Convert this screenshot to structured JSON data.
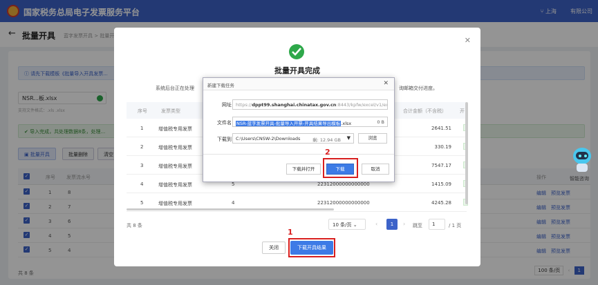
{
  "app": {
    "title": "国家税务总局电子发票服务平台",
    "user": "上海",
    "company": "有限公司"
  },
  "page": {
    "title": "批量开具",
    "breadcrumb_1": "蓝字发票开具",
    "breadcrumb_sep": ">",
    "breadcrumb_2": "批量开..."
  },
  "background": {
    "tip_text": "请先下载模板《批量导入开具发票...",
    "file_name": "NSR...板.xlsx",
    "file_note": "支持文件格式：.xls .xlsx",
    "import_tip": "导入完成，共处理数据8条，处理...",
    "buttons": [
      "批量开具",
      "批量删除",
      "清空"
    ],
    "columns": [
      "序号",
      "发票流水号",
      "操作"
    ],
    "rows": [
      {
        "idx": "1",
        "serial": "8"
      },
      {
        "idx": "2",
        "serial": "7"
      },
      {
        "idx": "3",
        "serial": "6"
      },
      {
        "idx": "4",
        "serial": "5"
      },
      {
        "idx": "5",
        "serial": "4"
      }
    ],
    "actions": [
      "编辑",
      "预览发票"
    ],
    "total": "共 8 条",
    "page_size": "100 条/页",
    "page_current": "1"
  },
  "modal": {
    "title": "批量开具完成",
    "desc_left": "系统后台正在处理",
    "desc_right": "询邮箱交付进度。",
    "columns": [
      "序号",
      "发票类型",
      "合计金额（不含税）",
      "开"
    ],
    "rows": [
      {
        "idx": "1",
        "type": "增值税专用发票",
        "serial": "",
        "no": "",
        "amount": "2641.51"
      },
      {
        "idx": "2",
        "type": "增值税专用发票",
        "serial": "",
        "no": "",
        "amount": "330.19"
      },
      {
        "idx": "3",
        "type": "增值税专用发票",
        "serial": "",
        "no": "",
        "amount": "7547.17"
      },
      {
        "idx": "4",
        "type": "增值税专用发票",
        "serial": "5",
        "no": "22312000000000000",
        "amount": "1415.09"
      },
      {
        "idx": "5",
        "type": "增值税专用发票",
        "serial": "4",
        "no": "22312000000000000",
        "amount": "4245.28"
      }
    ],
    "total": "共 8 条",
    "page_size": "10 条/页",
    "page_current": "1",
    "jump_label": "跳至",
    "jump_value": "1",
    "pages_label": "/ 1 页",
    "close_label": "关闭",
    "download_result_label": "下载开具结果"
  },
  "download_dialog": {
    "title": "新建下载任务",
    "url_label": "网址：",
    "url_prefix": "https://",
    "url_host": "dppt99.shanghai.chinatax.gov.cn",
    "url_rest": ":8443/kpfw/excel/v1/excelError",
    "filename_label": "文件名：",
    "filename_selected": "NSR-蓝字发票开具-批量导入开票-开具结果导出模板",
    "filename_ext": ".xlsx",
    "filesize": "0 B",
    "downloadto_label": "下载到：",
    "path": "C:\\Users\\CNSW-2\\Downloads",
    "disk_space": "剩: 12.94 GB",
    "browse_label": "浏览",
    "open_label": "下载并打开",
    "download_label": "下载",
    "cancel_label": "取消"
  },
  "annotations": {
    "step1": "1",
    "step2": "2"
  },
  "assistant": {
    "label": "智能咨询"
  }
}
